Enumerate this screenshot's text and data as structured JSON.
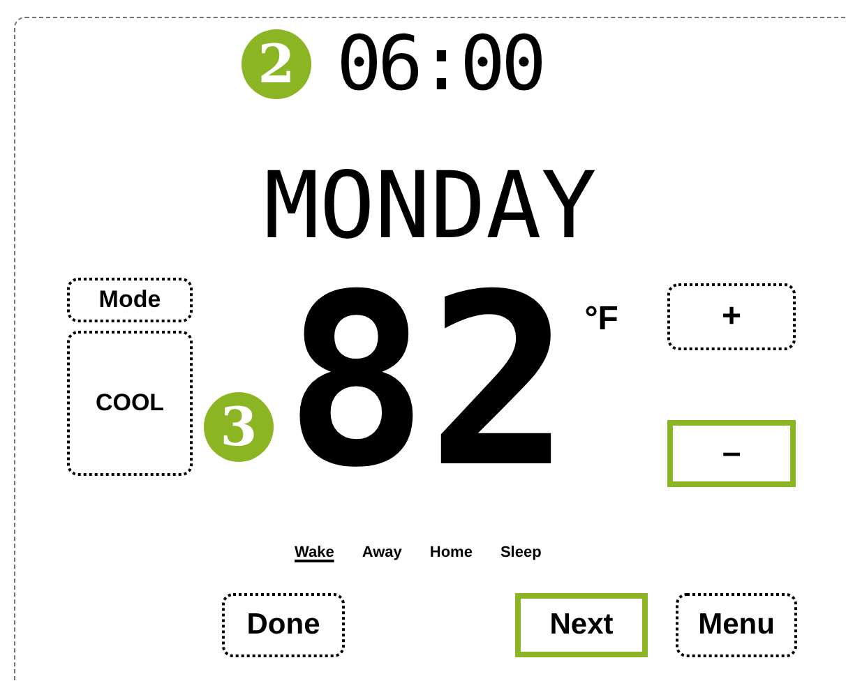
{
  "schedule": {
    "callout": "2",
    "time": "06:00",
    "day": "MONDAY"
  },
  "mode": {
    "label": "Mode",
    "value": "COOL"
  },
  "temperature": {
    "callout": "3",
    "value": "82",
    "unit": "°F"
  },
  "adjust_buttons": [
    {
      "label": "+",
      "highlighted": false
    },
    {
      "label": "–",
      "highlighted": true
    }
  ],
  "periods": [
    {
      "label": "Wake",
      "selected": true
    },
    {
      "label": "Away",
      "selected": false
    },
    {
      "label": "Home",
      "selected": false
    },
    {
      "label": "Sleep",
      "selected": false
    }
  ],
  "buttons": [
    {
      "label": "Done",
      "highlighted": false
    },
    {
      "label": "Next",
      "highlighted": true
    },
    {
      "label": "Menu",
      "highlighted": false
    }
  ]
}
